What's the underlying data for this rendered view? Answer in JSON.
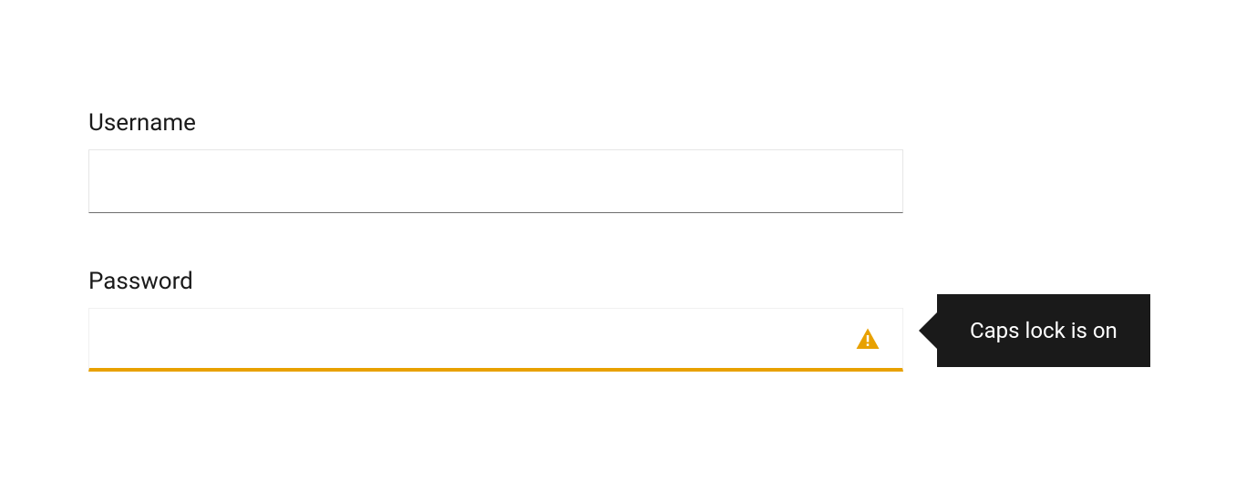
{
  "form": {
    "username_label": "Username",
    "username_value": "",
    "password_label": "Password",
    "password_value": ""
  },
  "tooltip": {
    "message": "Caps lock is on"
  },
  "colors": {
    "warning": "#e8a100",
    "tooltip_bg": "#1a1a1a"
  }
}
